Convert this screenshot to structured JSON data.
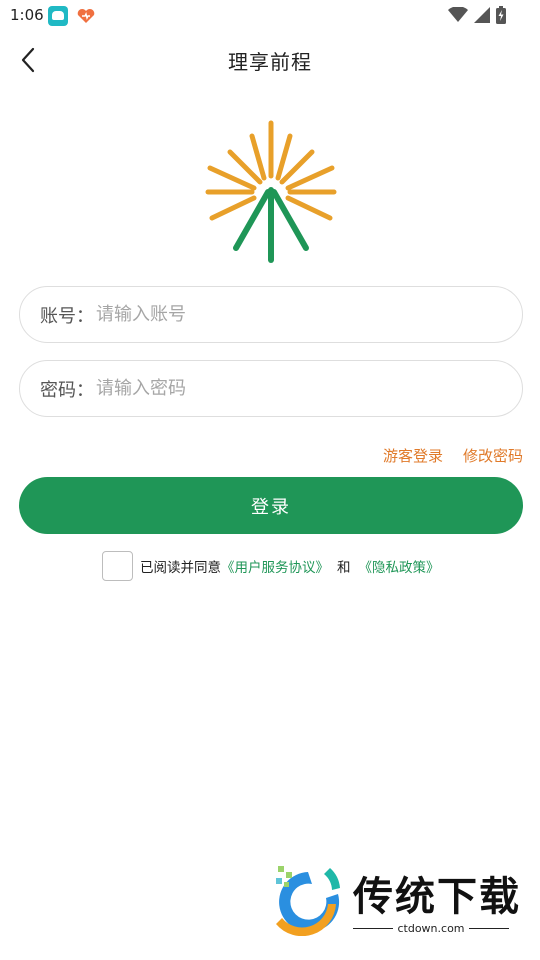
{
  "status_bar": {
    "time": "1:06",
    "icons": [
      "app-notification-icon",
      "heart-notification-icon",
      "wifi-icon",
      "cellular-signal-icon",
      "battery-charging-icon"
    ]
  },
  "nav": {
    "title": "理享前程",
    "back_icon": "chevron-left-icon"
  },
  "logo": {
    "icon": "sunburst-logo",
    "colors": {
      "orange": "#e8a02a",
      "green": "#1f9657"
    }
  },
  "form": {
    "account_label": "账号：",
    "account_placeholder": "请输入账号",
    "account_value": "",
    "password_label": "密码：",
    "password_placeholder": "请输入密码",
    "password_value": ""
  },
  "links": {
    "guest_login": "游客登录",
    "change_password": "修改密码"
  },
  "login_button": "登录",
  "agreement": {
    "checked": false,
    "prefix": "已阅读并同意",
    "user_agreement": "《用户服务协议》",
    "and": "和",
    "privacy_policy": "《隐私政策》"
  },
  "watermark": {
    "title": "传统下载",
    "subtitle": "ctdown.com"
  },
  "colors": {
    "primary": "#1f9657",
    "link_orange": "#e07a2a",
    "border": "#dedede",
    "placeholder": "#a6a6a6"
  }
}
